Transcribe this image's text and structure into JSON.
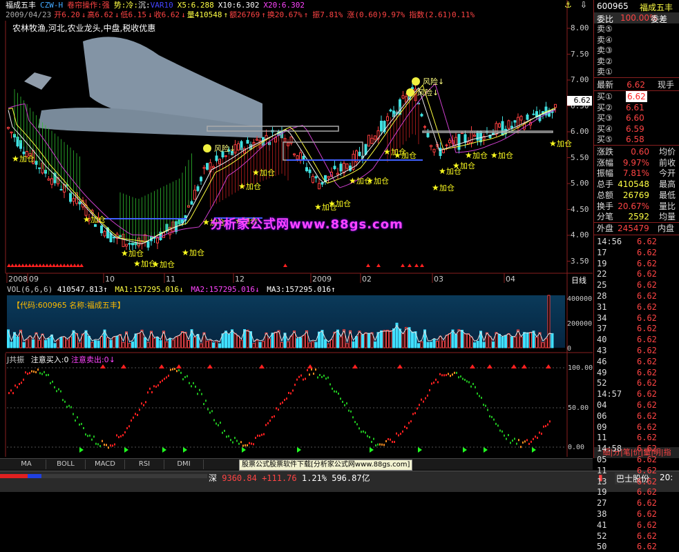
{
  "header": {
    "stock_name": "福成五丰",
    "indicator": "CZW-H",
    "op": "卷帘操作:强",
    "trend": "势:冷:",
    "sink": "沉:",
    "var": "VAR10",
    "x5": "X5:6.288",
    "x10": "X10:6.302",
    "x20": "X20:6.302"
  },
  "quote_line": {
    "date": "2009/04/23",
    "open": "开6.20",
    "high": "高6.62",
    "low": "低6.15",
    "close": "收6.62",
    "volume": "量410548",
    "amount": "额26769",
    "turnover": "换20.67%",
    "amplitude": "振7.81%",
    "change": "涨(0.60)9.97%",
    "index": "指数(2.61)0.11%"
  },
  "tags": "农林牧渔,河北,农业龙头,中盘,税收优惠",
  "price_axis": [
    "8.00",
    "7.50",
    "7.00",
    "6.50",
    "6.00",
    "5.50",
    "5.00",
    "4.50",
    "4.00",
    "3.50"
  ],
  "price_tag": "6.62",
  "date_axis": [
    "2008",
    "09",
    "10",
    "11",
    "12",
    "2009",
    "02",
    "03",
    "04"
  ],
  "date_axis_label": "日线",
  "annotations": {
    "risk": "风险",
    "add": "加仓"
  },
  "watermark": "分析家公式网www.88gs.com",
  "vol_panel": {
    "label": "VOL(6,6,6)",
    "vol": "410547.813",
    "ma1": "MA1:157295.016",
    "ma2": "MA2:157295.016",
    "ma3": "MA3:157295.016",
    "code_name": "【代码:600965 名称:福成五丰】",
    "axis": [
      "400000",
      "200000",
      "0"
    ]
  },
  "kdj_panel": {
    "label": "J共振",
    "buy": "注意买入:0",
    "sell": "注意卖出:0",
    "axis": [
      "100.00",
      "50.00",
      "0.00"
    ]
  },
  "tabs": [
    "MA",
    "BOLL",
    "MACD",
    "RSI",
    "DMI"
  ],
  "ad_banner": "股票公式股票软件下载[分析家公式网www.88gs.com]",
  "status": {
    "market": "深",
    "index_val": "9360.84",
    "index_chg": "+111.76",
    "index_pct": "1.21%",
    "turnover": "596.87亿",
    "right_name": "巴士股份",
    "time": "20:"
  },
  "right_panel": {
    "code": "600965",
    "name": "福成五丰",
    "weibi_lbl": "委比",
    "weibi_val": "100.00%",
    "weicha_lbl": "委差",
    "sells": [
      "卖⑤",
      "卖④",
      "卖③",
      "卖②",
      "卖①"
    ],
    "latest_lbl": "最新",
    "latest_val": "6.62",
    "xianshou_lbl": "现手",
    "buys": [
      {
        "lbl": "买①",
        "val": "6.62"
      },
      {
        "lbl": "买②",
        "val": "6.61"
      },
      {
        "lbl": "买③",
        "val": "6.60"
      },
      {
        "lbl": "买④",
        "val": "6.59"
      },
      {
        "lbl": "买⑤",
        "val": "6.58"
      }
    ],
    "stats": [
      {
        "lbl": "涨跌",
        "val": "0.60",
        "lbl2": "均价"
      },
      {
        "lbl": "涨幅",
        "val": "9.97%",
        "lbl2": "前收"
      },
      {
        "lbl": "振幅",
        "val": "7.81%",
        "lbl2": "今开"
      },
      {
        "lbl": "总手",
        "val": "410548",
        "lbl2": "最高"
      },
      {
        "lbl": "总额",
        "val": "26769",
        "lbl2": "最低"
      },
      {
        "lbl": "换手",
        "val": "20.67%",
        "lbl2": "量比"
      },
      {
        "lbl": "分笔",
        "val": "2592",
        "lbl2": "均量"
      }
    ],
    "waipan_lbl": "外盘",
    "waipan_val": "245479",
    "neipan_lbl": "内盘",
    "ticks": [
      {
        "t": "14:56",
        "v": "6.62"
      },
      {
        "t": "17",
        "v": "6.62"
      },
      {
        "t": "19",
        "v": "6.62"
      },
      {
        "t": "22",
        "v": "6.62"
      },
      {
        "t": "25",
        "v": "6.62"
      },
      {
        "t": "28",
        "v": "6.62"
      },
      {
        "t": "31",
        "v": "6.62"
      },
      {
        "t": "34",
        "v": "6.62"
      },
      {
        "t": "37",
        "v": "6.62"
      },
      {
        "t": "40",
        "v": "6.62"
      },
      {
        "t": "43",
        "v": "6.62"
      },
      {
        "t": "46",
        "v": "6.62"
      },
      {
        "t": "49",
        "v": "6.62"
      },
      {
        "t": "52",
        "v": "6.62"
      },
      {
        "t": "14:57",
        "v": "6.62"
      },
      {
        "t": "04",
        "v": "6.62"
      },
      {
        "t": "06",
        "v": "6.62"
      },
      {
        "t": "09",
        "v": "6.62"
      },
      {
        "t": "11",
        "v": "6.62"
      },
      {
        "t": "14:58",
        "v": "6.62"
      },
      {
        "t": "05",
        "v": "6.62"
      },
      {
        "t": "11",
        "v": "6.62"
      },
      {
        "t": "13",
        "v": "6.62"
      },
      {
        "t": "19",
        "v": "6.62"
      },
      {
        "t": "27",
        "v": "6.62"
      },
      {
        "t": "38",
        "v": "6.62"
      },
      {
        "t": "41",
        "v": "6.62"
      },
      {
        "t": "52",
        "v": "6.62"
      },
      {
        "t": "50",
        "v": "6.62"
      }
    ],
    "bottom_tabs": "细|分|笔|价|量|明|指"
  }
}
